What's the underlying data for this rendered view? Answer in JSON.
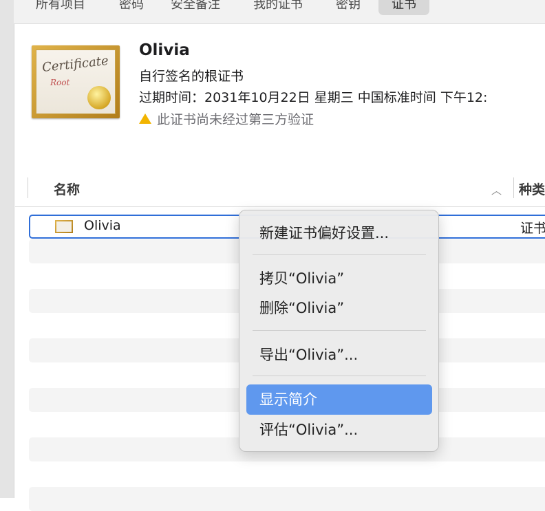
{
  "tabs": [
    "所有项目",
    "密码",
    "安全备注",
    "我的证书",
    "密钥",
    "证书"
  ],
  "active_tab": "证书",
  "certificate": {
    "icon_title": "Certificate",
    "icon_subtitle": "Root",
    "name": "Olivia",
    "kind": "自行签名的根证书",
    "expiry": "过期时间：2031年10月22日 星期三 中国标准时间 下午12:",
    "warning": "此证书尚未经过第三方验证"
  },
  "table": {
    "col_name": "名称",
    "col_kind": "种类",
    "rows": [
      {
        "name": "Olivia",
        "kind": "证书"
      }
    ]
  },
  "context_menu": {
    "items": [
      "新建证书偏好设置...",
      "拷贝“Olivia”",
      "删除“Olivia”",
      "导出“Olivia”...",
      "显示简介",
      "评估“Olivia”..."
    ],
    "highlighted": "显示简介"
  }
}
